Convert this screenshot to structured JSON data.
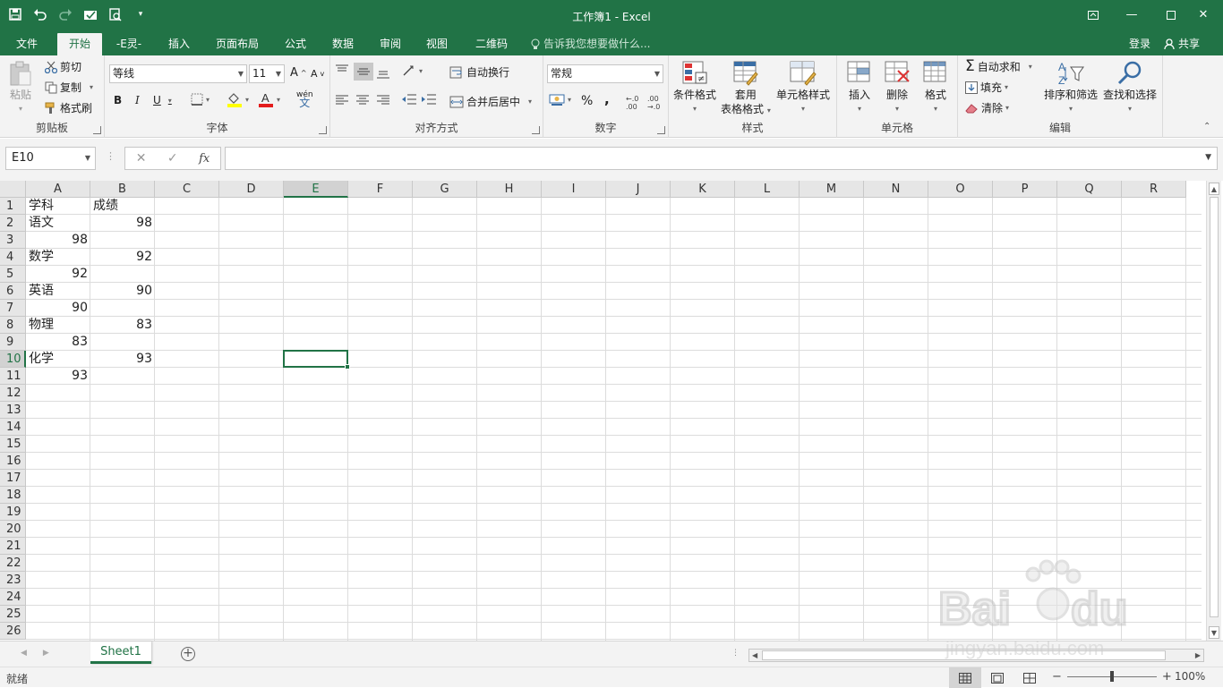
{
  "app": {
    "title": "工作簿1 - Excel"
  },
  "quick_access": {
    "icons": [
      "save-icon",
      "undo-icon",
      "redo-icon",
      "touch-mode-icon",
      "print-preview-icon",
      "customize-icon"
    ]
  },
  "tabs": [
    "文件",
    "开始",
    "-E灵-",
    "插入",
    "页面布局",
    "公式",
    "数据",
    "审阅",
    "视图",
    "二维码"
  ],
  "active_tab": "开始",
  "tell_me": "告诉我您想要做什么...",
  "account": {
    "login": "登录",
    "share": "共享"
  },
  "ribbon": {
    "clipboard": {
      "label": "剪贴板",
      "paste": "粘贴",
      "cut": "剪切",
      "copy": "复制",
      "format_painter": "格式刷"
    },
    "font": {
      "label": "字体",
      "font_name": "等线",
      "font_size": "11",
      "bold": "B",
      "italic": "I",
      "underline": "U",
      "grow": "A",
      "shrink": "A",
      "phonetic": "wén"
    },
    "alignment": {
      "label": "对齐方式",
      "wrap_text": "自动换行",
      "merge_center": "合并后居中"
    },
    "number": {
      "label": "数字",
      "format": "常规",
      "percent": "%",
      "comma": ","
    },
    "styles": {
      "label": "样式",
      "conditional": "条件格式",
      "table_line1": "套用",
      "table_line2": "表格格式",
      "cell_styles": "单元格样式"
    },
    "cells": {
      "label": "单元格",
      "insert": "插入",
      "delete": "删除",
      "format": "格式"
    },
    "editing": {
      "label": "编辑",
      "autosum": "自动求和",
      "fill": "填充",
      "clear": "清除",
      "sort_filter": "排序和筛选",
      "find_select": "查找和选择"
    }
  },
  "formula_bar": {
    "name_box": "E10",
    "fx": "fx",
    "formula": ""
  },
  "columns": [
    "A",
    "B",
    "C",
    "D",
    "E",
    "F",
    "G",
    "H",
    "I",
    "J",
    "K",
    "L",
    "M",
    "N",
    "O",
    "P",
    "Q",
    "R"
  ],
  "rows": [
    "1",
    "2",
    "3",
    "4",
    "5",
    "6",
    "7",
    "8",
    "9",
    "10",
    "11",
    "12",
    "13",
    "14",
    "15",
    "16",
    "17",
    "18",
    "19",
    "20",
    "21",
    "22",
    "23",
    "24",
    "25",
    "26"
  ],
  "selected": {
    "column": "E",
    "row": "10"
  },
  "sheet": {
    "A1": "学科",
    "B1": "成绩",
    "A2": "语文",
    "B2": "98",
    "A3": "98",
    "A4": "数学",
    "B4": "92",
    "A5": "92",
    "A6": "英语",
    "B6": "90",
    "A7": "90",
    "A8": "物理",
    "B8": "83",
    "A9": "83",
    "A10": "化学",
    "B10": "93",
    "A11": "93"
  },
  "sheet_tabs": [
    "Sheet1"
  ],
  "status": {
    "ready": "就绪",
    "zoom": "100%"
  },
  "colors": {
    "accent": "#217346"
  }
}
